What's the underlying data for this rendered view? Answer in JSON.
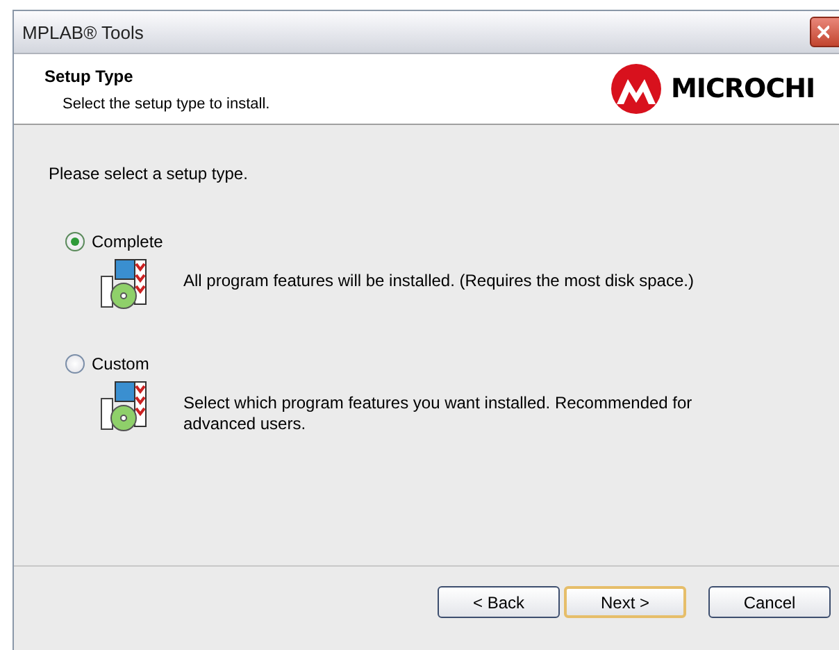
{
  "window": {
    "title": "MPLAB® Tools"
  },
  "header": {
    "title": "Setup Type",
    "subtitle": "Select the setup type to install.",
    "logo_text": "MICROCHI"
  },
  "prompt": "Please select a setup type.",
  "options": [
    {
      "label": "Complete",
      "selected": true,
      "description": "All program features will be installed. (Requires the most disk space.)"
    },
    {
      "label": "Custom",
      "selected": false,
      "description": "Select which program features you want installed. Recommended for advanced users."
    }
  ],
  "buttons": [
    {
      "label": "< Back",
      "default": false
    },
    {
      "label": "Next >",
      "default": true
    },
    {
      "label": "Cancel",
      "default": false
    }
  ]
}
